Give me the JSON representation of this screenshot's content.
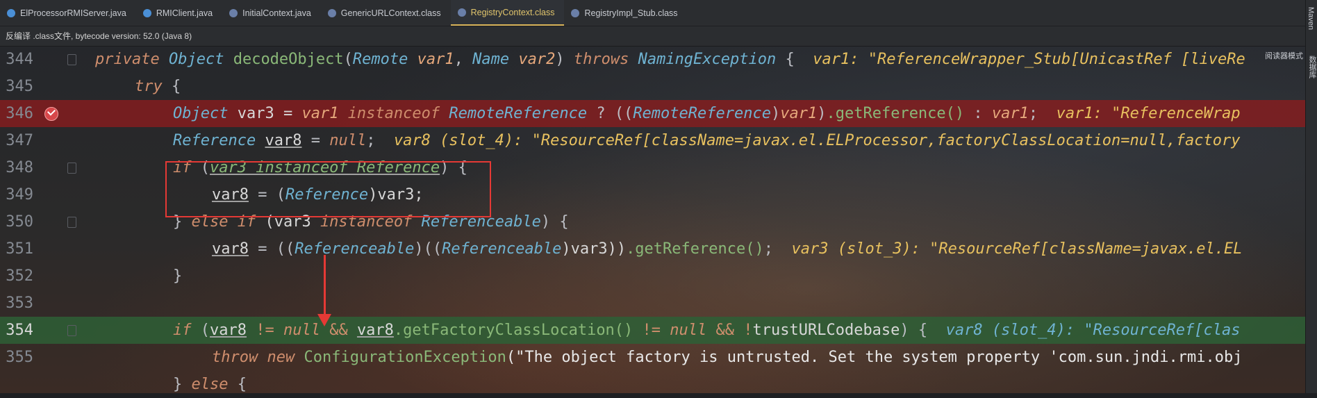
{
  "tabs": [
    {
      "label": "ElProcessorRMIServer.java",
      "kind": "java",
      "active": false
    },
    {
      "label": "RMIClient.java",
      "kind": "java",
      "active": false
    },
    {
      "label": "InitialContext.java",
      "kind": "class",
      "active": false
    },
    {
      "label": "GenericURLContext.class",
      "kind": "class",
      "active": false
    },
    {
      "label": "RegistryContext.class",
      "kind": "class",
      "active": true
    },
    {
      "label": "RegistryImpl_Stub.class",
      "kind": "class",
      "active": false
    }
  ],
  "banner": "反编译 .class文件, bytecode version: 52.0 (Java 8)",
  "right_panel": {
    "maven": "Maven",
    "database": "数据库",
    "reader_mode": "阅读器模式"
  },
  "lines": {
    "n344": "344",
    "n345": "345",
    "n346": "346",
    "n347": "347",
    "n348": "348",
    "n349": "349",
    "n350": "350",
    "n351": "351",
    "n352": "352",
    "n353": "353",
    "n354": "354",
    "n355": "355"
  },
  "code": {
    "l344": {
      "kw1": "private",
      "t1": "Object",
      "fn": "decodeObject",
      "p1": "(",
      "t2": "Remote",
      "a1": "var1",
      "c1": ", ",
      "t3": "Name",
      "a2": "var2",
      "p2": ")",
      "kw2": "throws",
      "t4": "NamingException",
      "p3": " {",
      "hint": "var1: \"ReferenceWrapper_Stub[UnicastRef [liveRe"
    },
    "l345": {
      "kw": "try",
      "p": " {"
    },
    "l346": {
      "t1": "Object",
      "v3": " var3 = ",
      "a1": "var1",
      "kw": "instanceof",
      "t2": "RemoteReference",
      "q": " ? ((",
      "t3": "RemoteReference",
      "a2": "var1",
      "call": ".getReference()",
      "p": " : ",
      "a3": "var1",
      "semi": ";",
      "hint": "var1: \"ReferenceWrap"
    },
    "l347": {
      "t1": "Reference",
      "v8": "var8",
      "eq": " = ",
      "kw": "null",
      "semi": ";",
      "hint": "var8 (slot_4): \"ResourceRef[className=javax.el.ELProcessor,factoryClassLocation=null,factory"
    },
    "l348": {
      "kw": "if",
      "p1": " (",
      "u": "var3 instanceof Reference",
      "p2": ") {"
    },
    "l349": {
      "v8": "var8",
      "eq": " = (",
      "t": "Reference",
      "rest": ")var3;"
    },
    "l350": {
      "b": "} ",
      "kw1": "else if",
      "p1": " (var3 ",
      "kw2": "instanceof",
      "t": "Referenceable",
      "p2": ") {"
    },
    "l351": {
      "v8": "var8",
      "eq": " = ((",
      "t1": "Referenceable",
      "p1": ")((",
      "t2": "Referenceable",
      "p2": ")var3))",
      "call": ".getReference()",
      "semi": ";",
      "hint": "var3 (slot_3): \"ResourceRef[className=javax.el.EL"
    },
    "l352": {
      "b": "}"
    },
    "l354": {
      "kw1": "if",
      "p1": " (",
      "v8a": "var8",
      "ne": " != ",
      "kw2": "null",
      "and": " && ",
      "v8b": "var8",
      "call": ".getFactoryClassLocation()",
      "ne2": " != ",
      "kw3": "null",
      "and2": " && !",
      "tc": "trustURLCodebase",
      "p2": ") {",
      "hint": "var8 (slot_4): \"ResourceRef[clas"
    },
    "l355": {
      "kw1": "throw",
      "kw2": "new",
      "fn": "ConfigurationException",
      "str": "(\"The object factory is untrusted. Set the system property 'com.sun.jndi.rmi.obj"
    },
    "l356": {
      "b": "} ",
      "kw": "else",
      "p": " {"
    }
  },
  "colors": {
    "keyword": "#cf8e6d",
    "type": "#6fb3d2",
    "method": "#8ab878",
    "hint": "#e8c15f",
    "breakpoint_line": "#8c1c1e",
    "current_line": "#2e5f36",
    "annotation": "#e53935"
  }
}
